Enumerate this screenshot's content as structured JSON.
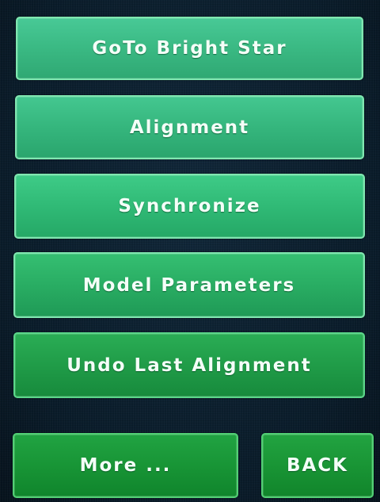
{
  "menu": {
    "items": [
      {
        "label": "GoTo Bright Star"
      },
      {
        "label": "Alignment"
      },
      {
        "label": "Synchronize"
      },
      {
        "label": "Model Parameters"
      },
      {
        "label": "Undo Last Alignment"
      }
    ]
  },
  "footer": {
    "more_label": "More ...",
    "back_label": "BACK"
  },
  "colors": {
    "background": "#0b1f2e",
    "button_top": "#48c996",
    "button_bottom": "#10852c",
    "text": "#f4fff8"
  }
}
